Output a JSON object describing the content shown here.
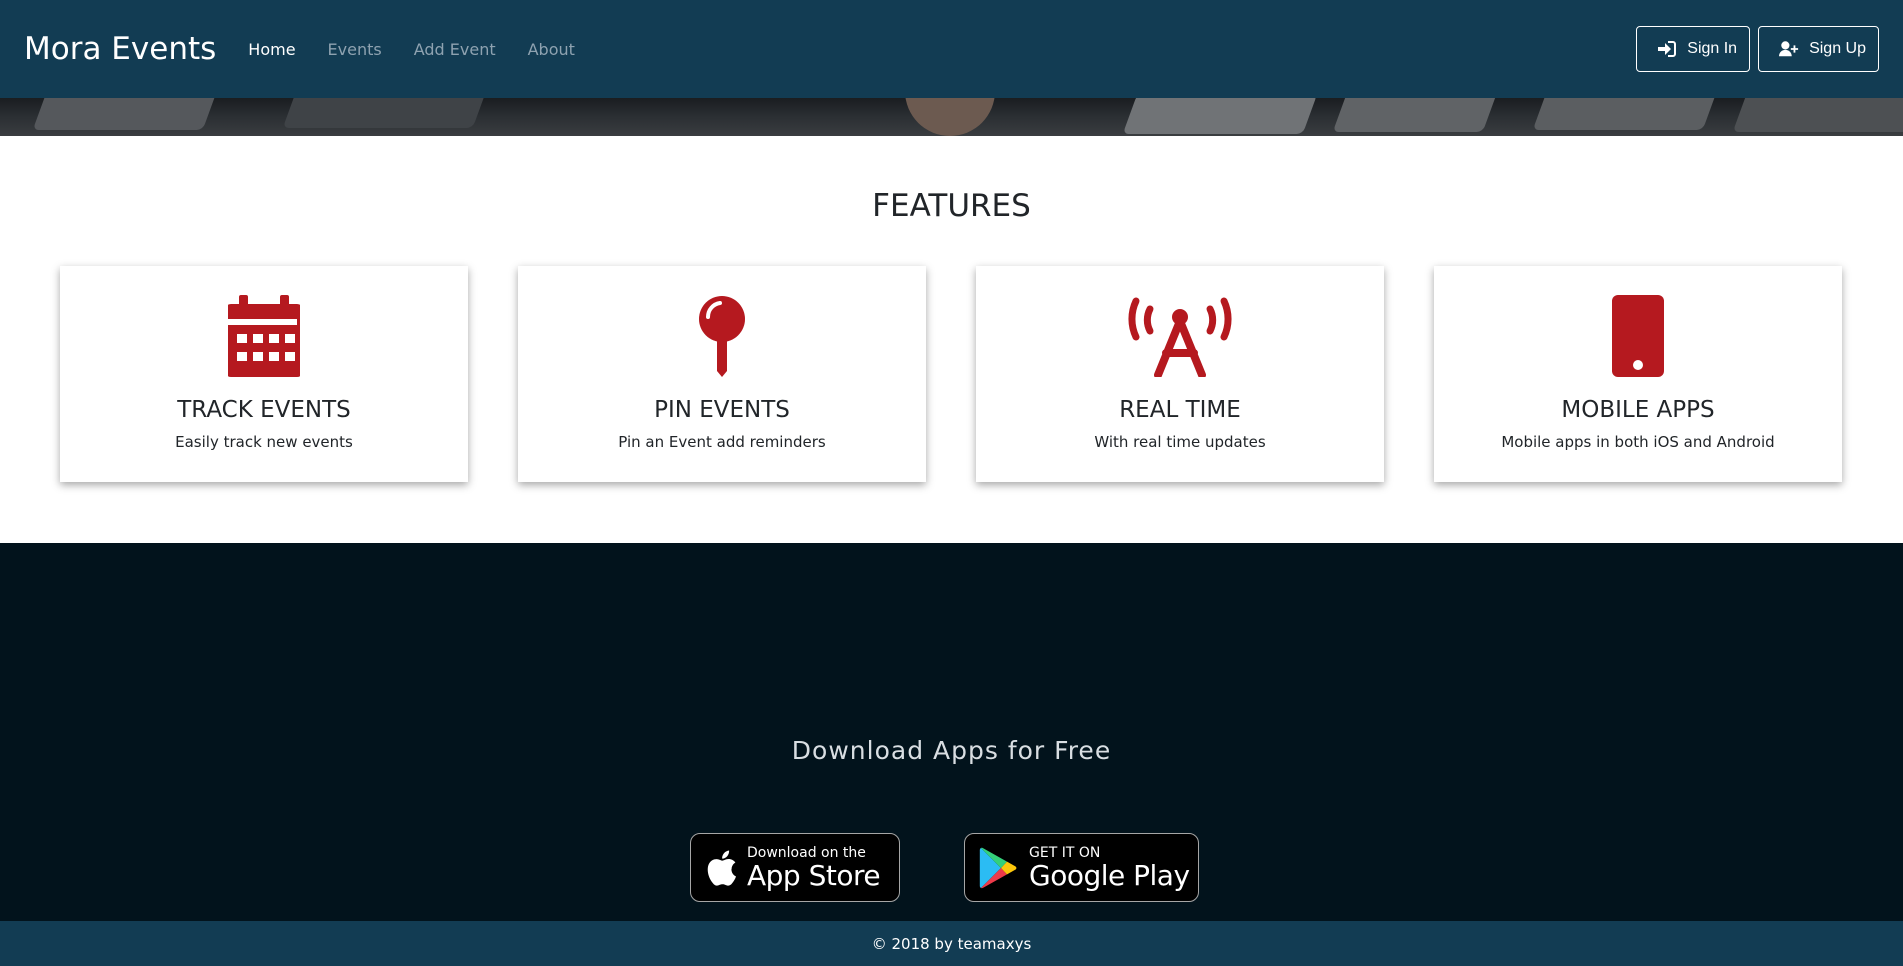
{
  "navbar": {
    "brand": "Mora Events",
    "links": [
      {
        "label": "Home",
        "active": true
      },
      {
        "label": "Events",
        "active": false
      },
      {
        "label": "Add Event",
        "active": false
      },
      {
        "label": "About",
        "active": false
      }
    ],
    "sign_in": "Sign In",
    "sign_up": "Sign Up"
  },
  "features": {
    "title": "FEATURES",
    "accent_color": "#b5191f",
    "cards": [
      {
        "icon": "calendar-icon",
        "title": "TRACK EVENTS",
        "desc": "Easily track new events"
      },
      {
        "icon": "pushpin-icon",
        "title": "PIN EVENTS",
        "desc": "Pin an Event add reminders"
      },
      {
        "icon": "broadcast-tower-icon",
        "title": "REAL TIME",
        "desc": "With real time updates"
      },
      {
        "icon": "mobile-phone-icon",
        "title": "MOBILE APPS",
        "desc": "Mobile apps in both iOS and Android"
      }
    ]
  },
  "download": {
    "title": "Download Apps for Free",
    "app_store": {
      "small": "Download on the",
      "big": "App Store"
    },
    "google_play": {
      "small": "GET IT ON",
      "big": "Google Play"
    }
  },
  "footer": {
    "text": "© 2018 by teamaxys"
  }
}
